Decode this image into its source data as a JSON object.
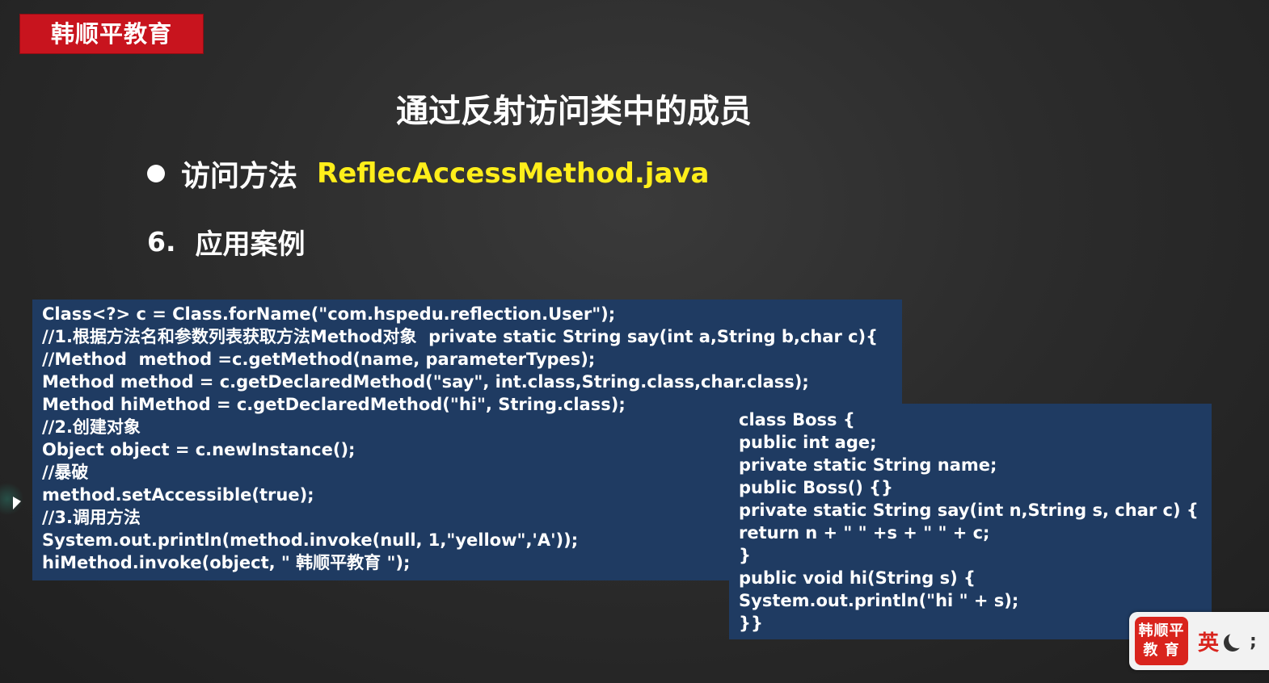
{
  "brand": {
    "name": "韩顺平教育"
  },
  "slide": {
    "title": "通过反射访问类中的成员",
    "bullet_label": "访问方法",
    "bullet_file": "ReflecAccessMethod.java",
    "section_number": "6.",
    "section_label": "应用案例"
  },
  "code_left": [
    "Class<?> c = Class.forName(\"com.hspedu.reflection.User\");",
    "//1.根据方法名和参数列表获取方法Method对象  private static String say(int a,String b,char c){",
    "//Method  method =c.getMethod(name, parameterTypes);",
    "Method method = c.getDeclaredMethod(\"say\", int.class,String.class,char.class);",
    "Method hiMethod = c.getDeclaredMethod(\"hi\", String.class);",
    "//2.创建对象",
    "Object object = c.newInstance();",
    "//暴破",
    "method.setAccessible(true);",
    "//3.调用方法",
    "System.out.println(method.invoke(null, 1,\"yellow\",'A'));",
    "hiMethod.invoke(object, \" 韩顺平教育 \");"
  ],
  "code_right": [
    "class Boss {",
    "public int age;",
    "private static String name;",
    "public Boss() {}",
    "private static String say(int n,String s, char c) {",
    "return n + \" \" +s + \" \" + c;",
    "}",
    "public void hi(String s) {",
    "System.out.println(\"hi \" + s);",
    "}}"
  ],
  "widget": {
    "logo_line1": "韩顺平",
    "logo_line2": "教 育",
    "ime_lang": "英",
    "punct": ";"
  },
  "colors": {
    "brand_red": "#c8141e",
    "code_bg": "#1f3b62",
    "filename_yellow": "#ffee1a"
  }
}
